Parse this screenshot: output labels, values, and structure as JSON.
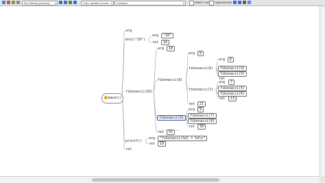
{
  "toolbar": {
    "filter_select": "No Filtering (remove)",
    "scope_select": "Core, details or more",
    "mode_select": "Contains",
    "match_case_label": "Match Case",
    "approximate_label": "Approximate"
  },
  "root": {
    "label": "main()"
  },
  "nodes": {
    "main_arg": "arg",
    "atoi_call": "atoi(\"10\")",
    "atoi_arg_label": "arg",
    "atoi_arg_value": "\"10\"",
    "atoi_ret_label": "ret",
    "atoi_ret_value": "10",
    "fib10": "fibonacci(10)",
    "fib10_arg_label": "arg",
    "fib10_arg_value": "10",
    "fib8": "fibonacci(8)",
    "fib8_arg_label": "arg",
    "fib8_arg_value": "8",
    "fib6": "fibonacci(6)",
    "fib6_arg_label": "arg",
    "fib6_arg_value": "6",
    "fib6_child_a": "fibonacci(4)",
    "fib6_child_b": "fibonacci(5)",
    "fib6_ret_label": "ret",
    "fib7": "fibonacci(7)",
    "fib7_arg_label": "arg",
    "fib7_arg_value": "7",
    "fib7_child_a": "fibonacci(5)",
    "fib7_child_b": "fibonacci(6)",
    "fib7_ret_label": "ret",
    "fib7_ret_value": "13",
    "fib8_ret_label": "ret",
    "fib8_ret_value": "21",
    "fib9": "fibonacci(9)",
    "fib9_arg_label": "arg",
    "fib9_arg_value": "9",
    "fib9_child_a": "fibonacci(7)",
    "fib9_child_b": "fibonacci(8)",
    "fib9_ret_label": "ret",
    "fib9_ret_value": "34",
    "fib10_ret_label": "ret",
    "fib10_ret_value": "55",
    "printf_call": "printf()",
    "printf_arg_label": "arg",
    "printf_arg_value": "\"fibonacci(%d) = %d\\n\"",
    "printf_ret_label": "ret",
    "printf_ret_value": "19",
    "main_ret": "ret"
  },
  "colors": {
    "edge": "#9a9a9a",
    "selected": "#3b53b3",
    "root_icon": "#e3a21a"
  }
}
